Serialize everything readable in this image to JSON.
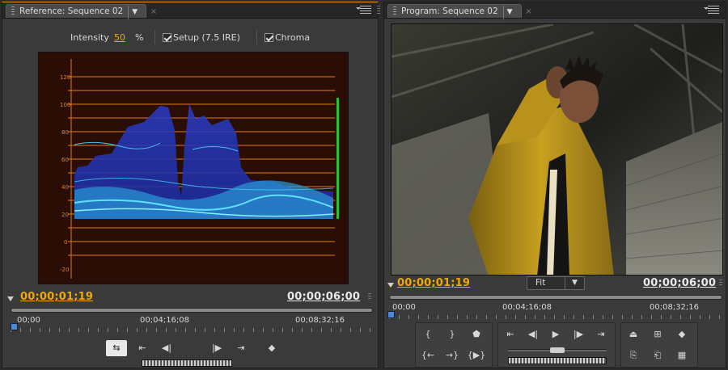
{
  "reference": {
    "tab_title": "Reference: Sequence 02",
    "intensity_label": "Intensity",
    "intensity_value": "50",
    "intensity_unit": "%",
    "setup_label": "Setup (7.5 IRE)",
    "chroma_label": "Chroma",
    "scope_labels": [
      "120",
      "100",
      "80",
      "60",
      "40",
      "20",
      "0",
      "-20"
    ],
    "current_timecode": "00;00;01;19",
    "duration_timecode": "00;00;06;00",
    "ruler_labels": [
      "00;00",
      "00;04;16;08",
      "00;08;32;16"
    ]
  },
  "program": {
    "tab_title": "Program: Sequence 02",
    "current_timecode": "00;00;01;19",
    "duration_timecode": "00;00;06;00",
    "fit_value": "Fit",
    "ruler_labels": [
      "00;00",
      "00;04;16;08",
      "00;08;32;16"
    ]
  },
  "colors": {
    "accent": "#f0a800",
    "scope_line": "#e07a1a",
    "waveform": "#39c8f0",
    "playhead": "#4a8ad8"
  }
}
